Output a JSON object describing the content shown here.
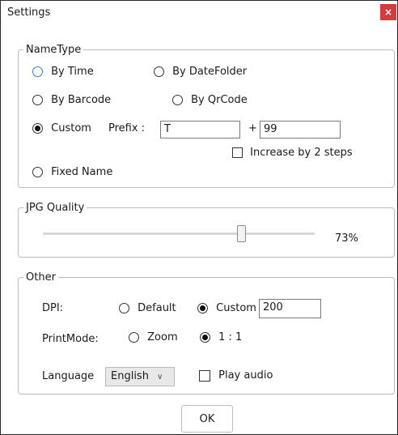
{
  "window": {
    "title": "Settings",
    "close_glyph": "×"
  },
  "nametype": {
    "legend": "NameType",
    "by_time": "By Time",
    "by_datefolder": "By DateFolder",
    "by_barcode": "By Barcode",
    "by_qrcode": "By QrCode",
    "custom": "Custom",
    "prefix_label": "Prefix :",
    "prefix_value": "T",
    "plus": "+",
    "number_value": "99",
    "increase_label": "Increase by 2 steps",
    "fixed_name": "Fixed Name",
    "selected": "Custom"
  },
  "jpg": {
    "legend": "JPG Quality",
    "value_text": "73%",
    "level_fraction": 0.73
  },
  "other": {
    "legend": "Other",
    "dpi_label": "DPI:",
    "dpi_default": "Default",
    "dpi_custom": "Custom",
    "dpi_value": "200",
    "dpi_selected": "Custom",
    "printmode_label": "PrintMode:",
    "printmode_zoom": "Zoom",
    "printmode_one": "1 : 1",
    "printmode_selected": "1 : 1",
    "language_label": "Language",
    "language_value": "English",
    "play_audio": "Play audio"
  },
  "footer": {
    "ok_label": "OK"
  }
}
